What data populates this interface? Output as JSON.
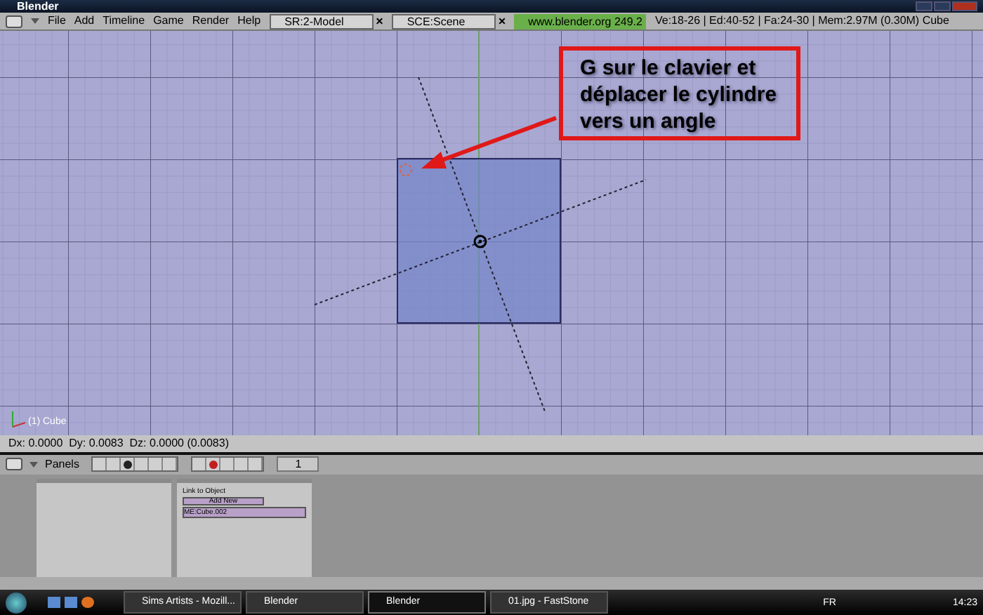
{
  "window": {
    "title": "Blender"
  },
  "menu": [
    "File",
    "Add",
    "Timeline",
    "Game",
    "Render",
    "Help"
  ],
  "scene_fields": [
    {
      "value": "SR:2-Model",
      "delete": "×"
    },
    {
      "value": "SCE:Scene",
      "delete": "×"
    }
  ],
  "link": "www.blender.org 249.2",
  "stats": "Ve:18-26 | Ed:40-52 | Fa:24-30 | Mem:2.97M (0.30M) Cube",
  "viewport": {
    "object_label": "(1) Cube",
    "annotation": "G sur le clavier et déplacer le cylindre vers un angle"
  },
  "status": "Dx: 0.0000  Dy: 0.0083  Dz: 0.0000 (0.0083)",
  "buttons_header": {
    "label": "Panels",
    "frame": "1"
  },
  "mesh_panel": {
    "link_label": "Link to Object",
    "add_button": "Add New",
    "mesh_name": "ME:Cube.002"
  },
  "taskbar": {
    "tasks": [
      {
        "label": "Sims Artists - Mozill...",
        "selected": false
      },
      {
        "label": "Blender",
        "selected": false
      },
      {
        "label": "Blender",
        "selected": true
      },
      {
        "label": "01.jpg - FastStone",
        "selected": false
      }
    ],
    "language": "FR",
    "clock": "14:23"
  }
}
